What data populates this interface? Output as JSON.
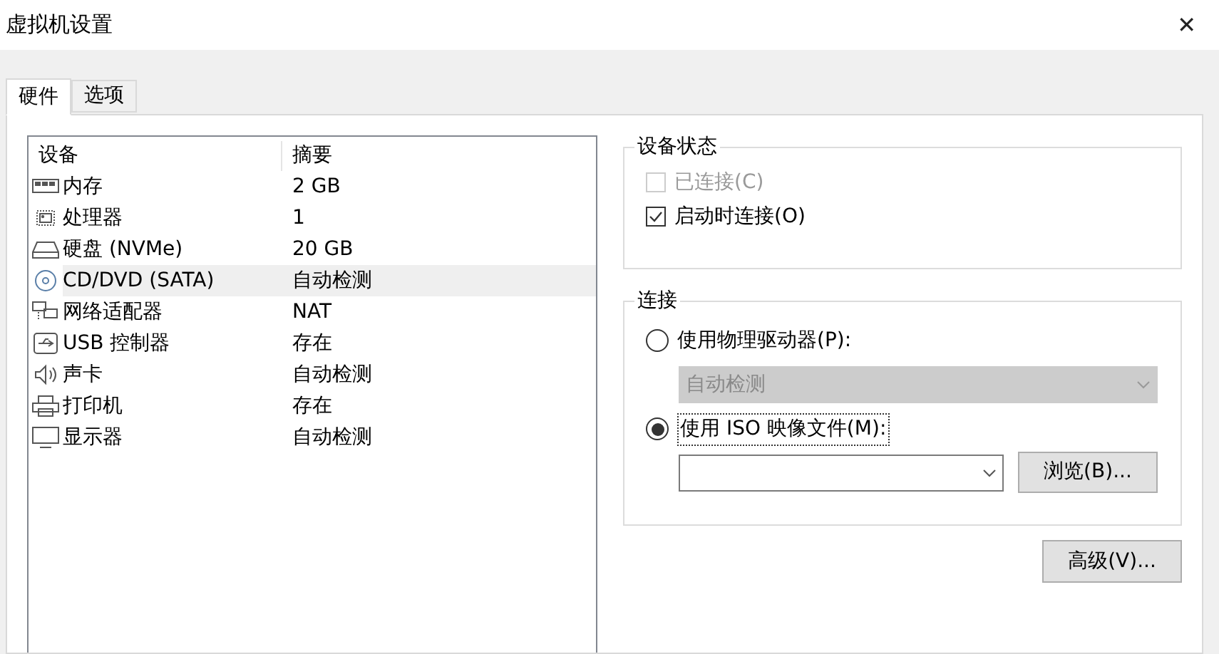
{
  "window": {
    "title": "虚拟机设置",
    "close": "✕"
  },
  "tabs": [
    {
      "label": "硬件",
      "selected": true
    },
    {
      "label": "选项",
      "selected": false
    }
  ],
  "device_list": {
    "columns": [
      "设备",
      "摘要"
    ],
    "rows": [
      {
        "kind": "memory",
        "device": "内存",
        "summary": "2 GB",
        "selected": false
      },
      {
        "kind": "cpu",
        "device": "处理器",
        "summary": "1",
        "selected": false
      },
      {
        "kind": "disk",
        "device": "硬盘 (NVMe)",
        "summary": "20 GB",
        "selected": false
      },
      {
        "kind": "cd",
        "device": "CD/DVD (SATA)",
        "summary": "自动检测",
        "selected": true
      },
      {
        "kind": "network",
        "device": "网络适配器",
        "summary": "NAT",
        "selected": false
      },
      {
        "kind": "usb",
        "device": "USB 控制器",
        "summary": "存在",
        "selected": false
      },
      {
        "kind": "sound",
        "device": "声卡",
        "summary": "自动检测",
        "selected": false
      },
      {
        "kind": "printer",
        "device": "打印机",
        "summary": "存在",
        "selected": false
      },
      {
        "kind": "display",
        "device": "显示器",
        "summary": "自动检测",
        "selected": false
      }
    ]
  },
  "device_status": {
    "title": "设备状态",
    "options": [
      {
        "label": "已连接(C)",
        "checked": false,
        "disabled": true
      },
      {
        "label": "启动时连接(O)",
        "checked": true,
        "disabled": false
      }
    ]
  },
  "connection": {
    "title": "连接",
    "physical_drive": {
      "label": "使用物理驱动器(P):",
      "selected": false,
      "dropdown": {
        "value": "自动检测",
        "disabled": true
      }
    },
    "iso_file": {
      "label": "使用 ISO 映像文件(M):",
      "selected": true,
      "dropdown": {
        "disabled": false
      },
      "browse_button": "浏览(B)..."
    }
  },
  "advanced_button": "高级(V)..."
}
